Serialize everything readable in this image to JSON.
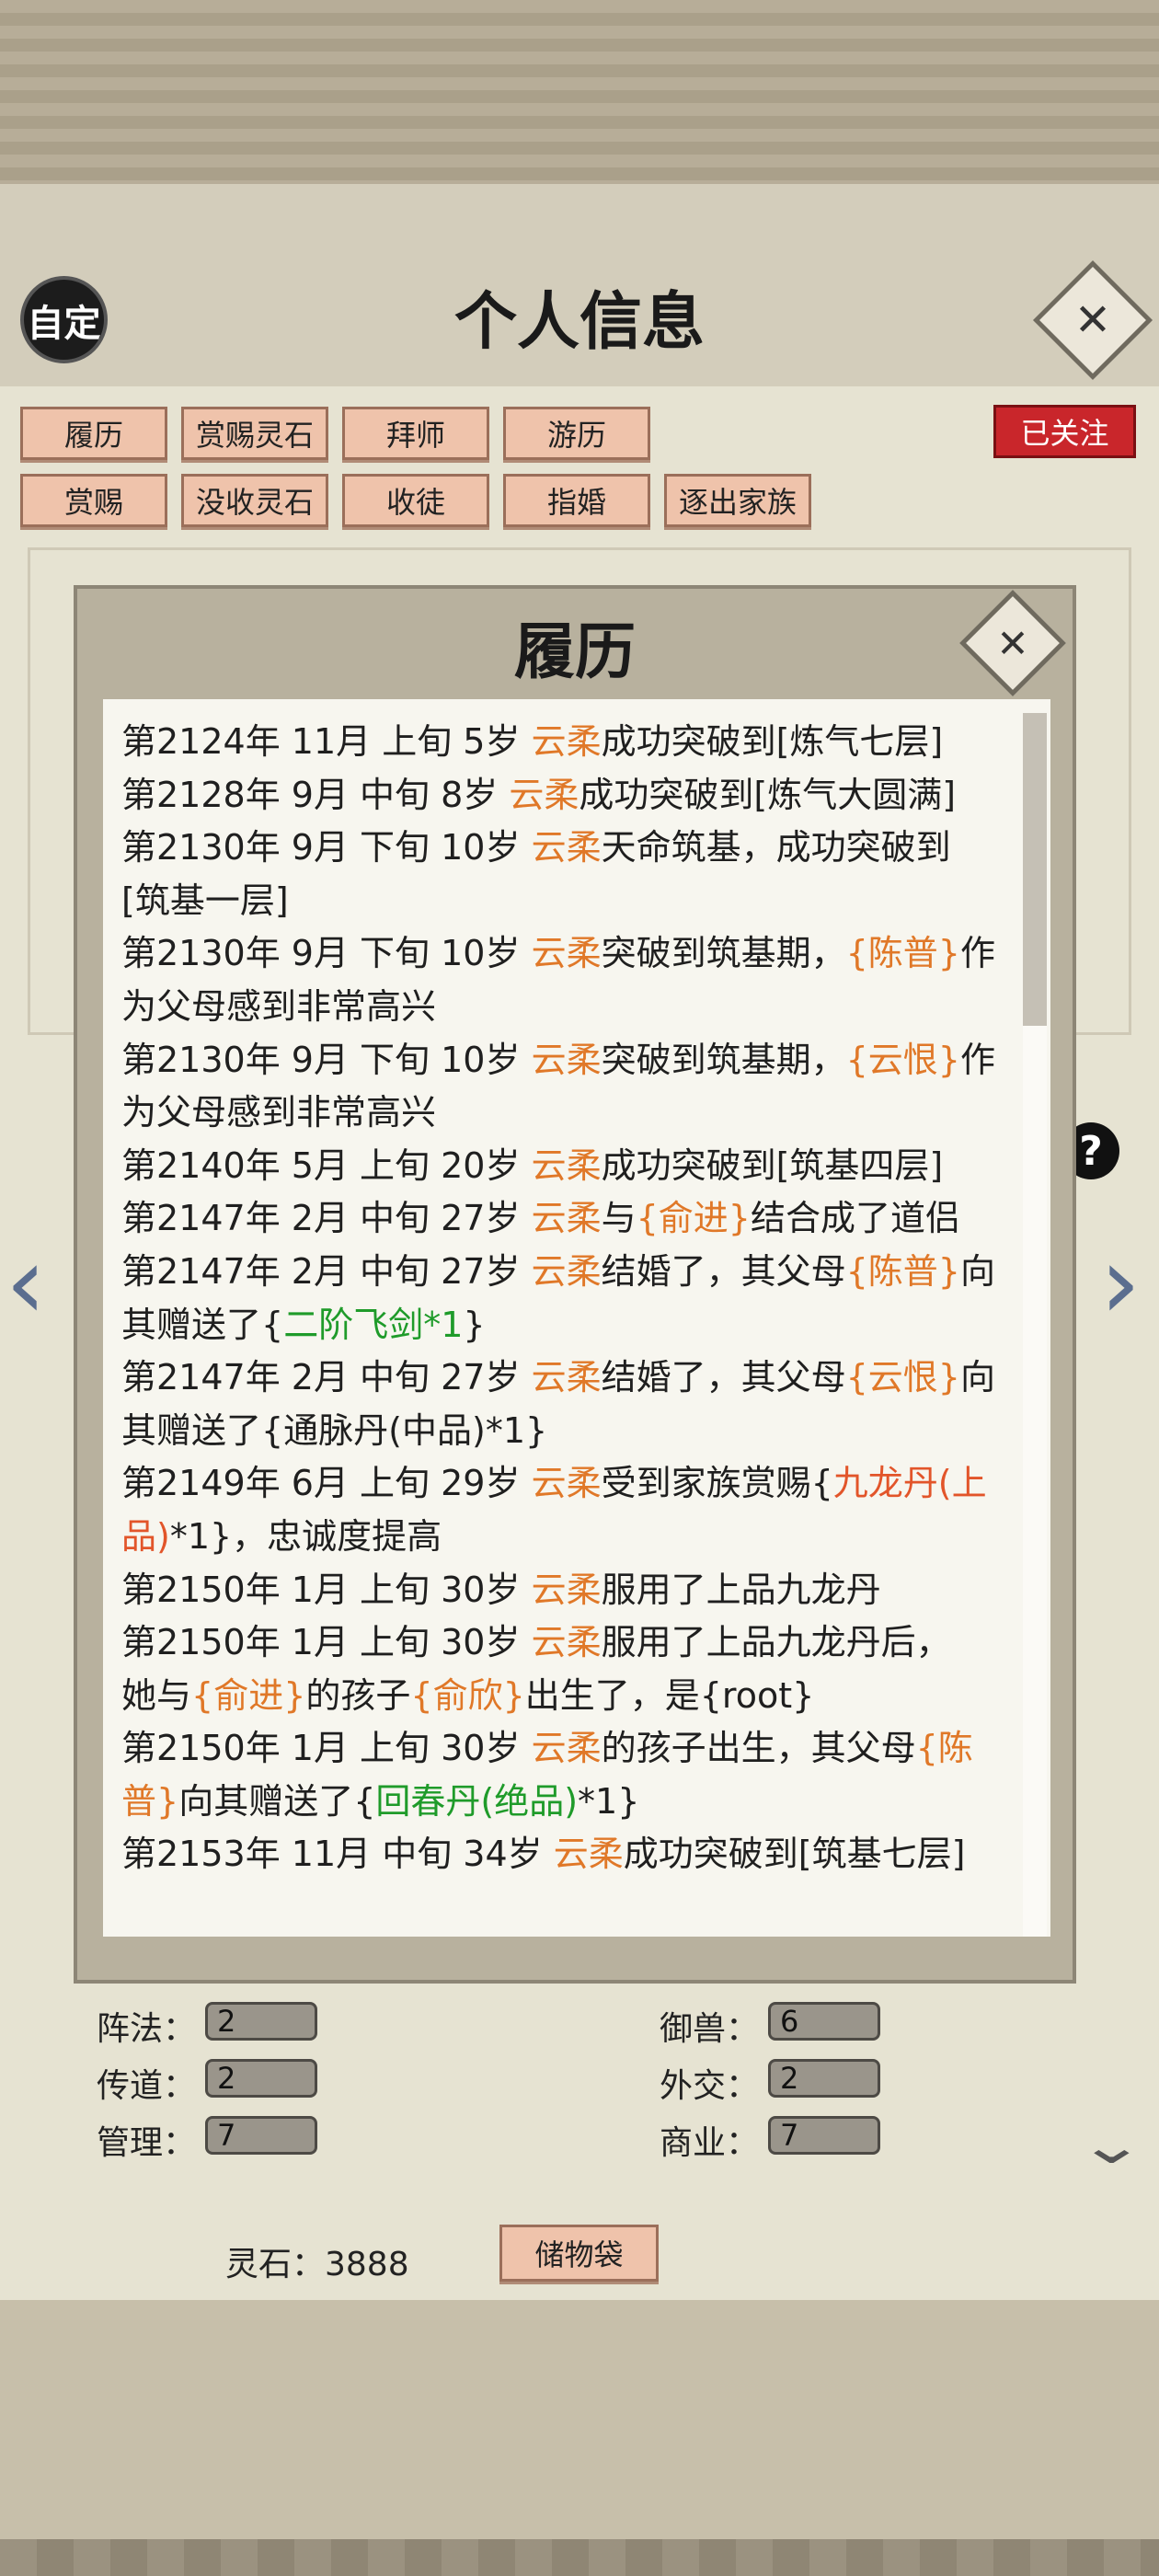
{
  "header": {
    "custom_label": "自定",
    "title": "个人信息",
    "close_symbol": "✕"
  },
  "actions_row1": [
    "履历",
    "赏赐灵石",
    "拜师",
    "游历"
  ],
  "actions_row2": [
    "赏赐",
    "没收灵石",
    "收徒",
    "指婚",
    "逐出家族"
  ],
  "follow_badge": "已关注",
  "stats_left": [
    {
      "label": "阵法：",
      "value": "2"
    },
    {
      "label": "传道：",
      "value": "2"
    },
    {
      "label": "管理：",
      "value": "7"
    }
  ],
  "stats_right": [
    {
      "label": "御兽：",
      "value": "6"
    },
    {
      "label": "外交：",
      "value": "2"
    },
    {
      "label": "商业：",
      "value": "7"
    }
  ],
  "footer": {
    "spirit_stone": "灵石：3888",
    "bag_label": "储物袋"
  },
  "modal": {
    "title": "履历",
    "close_symbol": "✕",
    "entries": [
      [
        [
          "第2124年 11月 上旬  5岁  ",
          ""
        ],
        [
          "云柔",
          "nm"
        ],
        [
          "成功突破到[炼气七层]",
          ""
        ]
      ],
      [
        [
          "第2128年 9月 中旬  8岁  ",
          ""
        ],
        [
          "云柔",
          "nm"
        ],
        [
          "成功突破到[炼气大圆满]",
          ""
        ]
      ],
      [
        [
          "第2130年 9月 下旬  10岁  ",
          ""
        ],
        [
          "云柔",
          "nm"
        ],
        [
          "天命筑基，成功突破到",
          ""
        ]
      ],
      [
        [
          "[筑基一层]",
          ""
        ]
      ],
      [
        [
          "第2130年 9月 下旬  10岁  ",
          ""
        ],
        [
          "云柔",
          "nm"
        ],
        [
          "突破到筑基期，",
          ""
        ],
        [
          "{陈普}",
          "nm"
        ],
        [
          "作",
          ""
        ]
      ],
      [
        [
          "为父母感到非常高兴",
          ""
        ]
      ],
      [
        [
          "第2130年 9月 下旬  10岁  ",
          ""
        ],
        [
          "云柔",
          "nm"
        ],
        [
          "突破到筑基期，",
          ""
        ],
        [
          "{云恨}",
          "nm"
        ],
        [
          "作",
          ""
        ]
      ],
      [
        [
          "为父母感到非常高兴",
          ""
        ]
      ],
      [
        [
          "第2140年 5月  上旬  20岁  ",
          ""
        ],
        [
          "云柔",
          "nm"
        ],
        [
          "成功突破到[筑基四层]",
          ""
        ]
      ],
      [
        [
          "第2147年 2月  中旬  27岁  ",
          ""
        ],
        [
          "云柔",
          "nm"
        ],
        [
          "与",
          ""
        ],
        [
          "{俞进}",
          "nm"
        ],
        [
          "结合成了道侣",
          ""
        ]
      ],
      [
        [
          "第2147年 2月  中旬  27岁  ",
          ""
        ],
        [
          "云柔",
          "nm"
        ],
        [
          "结婚了，其父母",
          ""
        ],
        [
          "{陈普}",
          "nm"
        ],
        [
          "向",
          ""
        ]
      ],
      [
        [
          "其赠送了{",
          ""
        ],
        [
          "二阶飞剑*1",
          "gr"
        ],
        [
          "}",
          ""
        ]
      ],
      [
        [
          "第2147年 2月  中旬  27岁  ",
          ""
        ],
        [
          "云柔",
          "nm"
        ],
        [
          "结婚了，其父母",
          ""
        ],
        [
          "{云恨}",
          "nm"
        ],
        [
          "向",
          ""
        ]
      ],
      [
        [
          "其赠送了{通脉丹(中品)*1}",
          ""
        ]
      ],
      [
        [
          "第2149年 6月  上旬  29岁  ",
          ""
        ],
        [
          "云柔",
          "nm"
        ],
        [
          "受到家族赏赐{",
          ""
        ],
        [
          "九龙丹(上",
          "rd"
        ]
      ],
      [
        [
          "品)",
          "rd"
        ],
        [
          "*1}，忠诚度提高",
          ""
        ]
      ],
      [
        [
          "第2150年 1月  上旬  30岁  ",
          ""
        ],
        [
          "云柔",
          "nm"
        ],
        [
          "服用了上品九龙丹",
          ""
        ]
      ],
      [
        [
          "第2150年 1月  上旬  30岁  ",
          ""
        ],
        [
          "云柔",
          "nm"
        ],
        [
          "服用了上品九龙丹后，",
          ""
        ]
      ],
      [
        [
          "她与",
          ""
        ],
        [
          "{俞进}",
          "nm"
        ],
        [
          "的孩子",
          ""
        ],
        [
          "{俞欣}",
          "nm"
        ],
        [
          "出生了，是{root}",
          ""
        ]
      ],
      [
        [
          "第2150年 1月  上旬  30岁  ",
          ""
        ],
        [
          "云柔",
          "nm"
        ],
        [
          "的孩子出生，其父母",
          ""
        ],
        [
          "{陈",
          "nm"
        ]
      ],
      [
        [
          "普}",
          "nm"
        ],
        [
          "向其赠送了{",
          ""
        ],
        [
          "回春丹(绝品)",
          "gr"
        ],
        [
          "*1}",
          ""
        ]
      ],
      [
        [
          "第2153年 11月 中旬  34岁  ",
          ""
        ],
        [
          "云柔",
          "nm"
        ],
        [
          "成功突破到[筑基七层]",
          ""
        ]
      ]
    ]
  },
  "colors": {
    "name": "#e07828",
    "gift": "#1f9b2a",
    "reward": "#e2552a",
    "badge": "#c9262b"
  }
}
